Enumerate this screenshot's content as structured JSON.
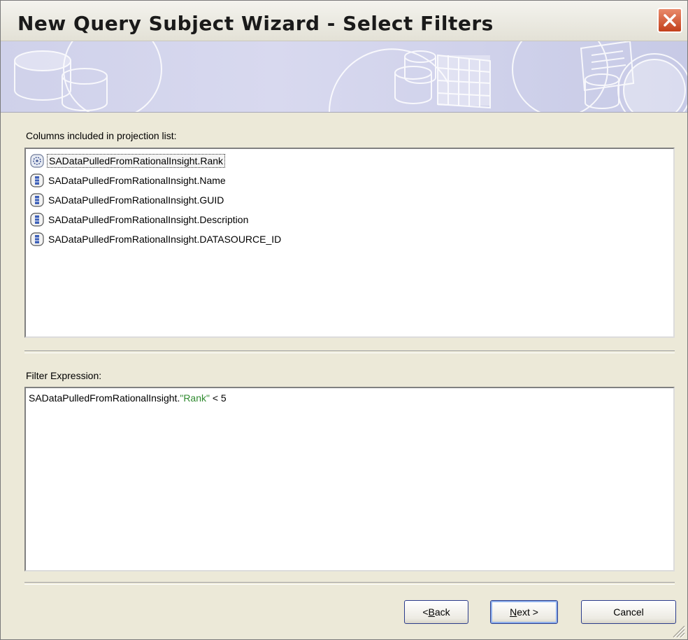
{
  "window": {
    "title": "New Query Subject Wizard - Select Filters"
  },
  "columns": {
    "label": "Columns included in projection list:",
    "items": [
      {
        "label": "SADataPulledFromRationalInsight.Rank",
        "icon": "calculated-column-icon",
        "selected": true
      },
      {
        "label": "SADataPulledFromRationalInsight.Name",
        "icon": "column-icon",
        "selected": false
      },
      {
        "label": "SADataPulledFromRationalInsight.GUID",
        "icon": "column-icon",
        "selected": false
      },
      {
        "label": "SADataPulledFromRationalInsight.Description",
        "icon": "column-icon",
        "selected": false
      },
      {
        "label": "SADataPulledFromRationalInsight.DATASOURCE_ID",
        "icon": "column-icon",
        "selected": false
      }
    ]
  },
  "filter": {
    "label": "Filter Expression:",
    "expression_prefix": "SADataPulledFromRationalInsight.",
    "expression_string": "\"Rank\"",
    "expression_suffix": " < 5"
  },
  "buttons": {
    "back_prefix": "< ",
    "back_mnemonic": "B",
    "back_rest": "ack",
    "next_mnemonic": "N",
    "next_rest": "ext >",
    "cancel": "Cancel"
  },
  "colors": {
    "string_literal": "#2f8a2f",
    "close_button": "#c3401b"
  }
}
